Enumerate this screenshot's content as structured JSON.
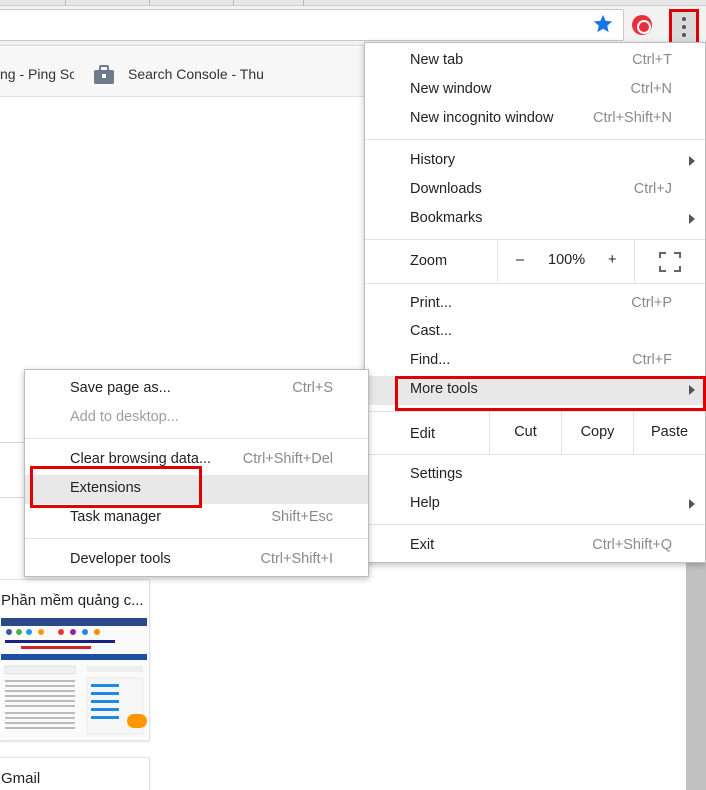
{
  "colors": {
    "accent_red": "#e00000",
    "star_blue": "#1a73e8",
    "ext_red": "#e8303d"
  },
  "toolbar": {
    "star_icon": "star-icon",
    "extension_icon": "extension-icon",
    "menu_icon": "more-vertical-icon"
  },
  "bookmarks": [
    {
      "label": "ng - Ping Sc"
    },
    {
      "label": "Search Console - Thu"
    }
  ],
  "tiles": [
    {
      "title": "Phần mềm quảng c..."
    },
    {
      "title": "Gmail"
    }
  ],
  "menu": {
    "new_tab": {
      "label": "New tab",
      "shortcut": "Ctrl+T"
    },
    "new_window": {
      "label": "New window",
      "shortcut": "Ctrl+N"
    },
    "new_incognito": {
      "label": "New incognito window",
      "shortcut": "Ctrl+Shift+N"
    },
    "history": {
      "label": "History"
    },
    "downloads": {
      "label": "Downloads",
      "shortcut": "Ctrl+J"
    },
    "bookmarks": {
      "label": "Bookmarks"
    },
    "zoom": {
      "label": "Zoom",
      "minus": "–",
      "value": "100%",
      "plus": "+"
    },
    "print": {
      "label": "Print...",
      "shortcut": "Ctrl+P"
    },
    "cast": {
      "label": "Cast..."
    },
    "find": {
      "label": "Find...",
      "shortcut": "Ctrl+F"
    },
    "more_tools": {
      "label": "More tools"
    },
    "edit": {
      "label": "Edit",
      "cut": "Cut",
      "copy": "Copy",
      "paste": "Paste"
    },
    "settings": {
      "label": "Settings"
    },
    "help": {
      "label": "Help"
    },
    "exit": {
      "label": "Exit",
      "shortcut": "Ctrl+Shift+Q"
    }
  },
  "submenu": {
    "save_page": {
      "label": "Save page as...",
      "shortcut": "Ctrl+S"
    },
    "add_desktop": {
      "label": "Add to desktop..."
    },
    "clear_data": {
      "label": "Clear browsing data...",
      "shortcut": "Ctrl+Shift+Del"
    },
    "extensions": {
      "label": "Extensions"
    },
    "task_manager": {
      "label": "Task manager",
      "shortcut": "Shift+Esc"
    },
    "dev_tools": {
      "label": "Developer tools",
      "shortcut": "Ctrl+Shift+I"
    }
  }
}
